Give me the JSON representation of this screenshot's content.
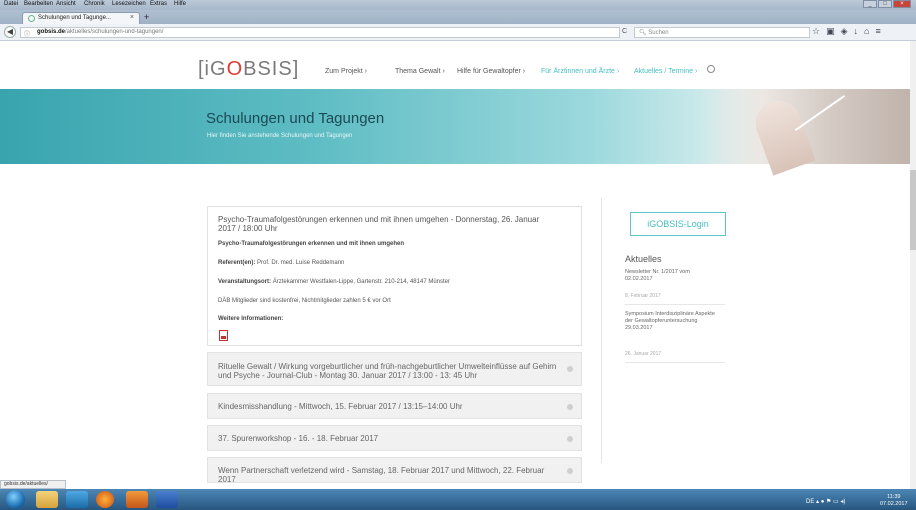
{
  "browser": {
    "menu": [
      "Datei",
      "Bearbeiten",
      "Ansicht",
      "Chronik",
      "Lesezeichen",
      "Extras",
      "Hilfe"
    ],
    "tab_title": "Schulungen und Tagunge...",
    "tab_close": "×",
    "new_tab": "+",
    "url_domain": "gobsis.de",
    "url_path": "/aktuelles/schulungen-und-tagungen/",
    "search_placeholder": "Suchen",
    "status_text": "gobsis.de/aktuelles/"
  },
  "site": {
    "logo_left": "[iG",
    "logo_accent": "O",
    "logo_right": "BSIS]",
    "nav": [
      {
        "label": "Zum Projekt",
        "active": false
      },
      {
        "label": "Thema Gewalt",
        "active": false
      },
      {
        "label": "Hilfe für Gewaltopfer",
        "active": false
      },
      {
        "label": "Für Ärztinnen und Ärzte",
        "active": true
      },
      {
        "label": "Aktuelles / Termine",
        "active": true
      }
    ]
  },
  "banner": {
    "title": "Schulungen und Tagungen",
    "subtitle": "Hier finden Sie anstehende Schulungen und Tagungen"
  },
  "events": {
    "expanded": {
      "title": "Psycho-Traumafolgestörungen erkennen und mit ihnen umgehen - Donnerstag, 26. Januar 2017 / 18:00 Uhr",
      "subtitle": "Psycho-Traumafolgestörungen erkennen und mit ihnen umgehen",
      "speaker_label": "Referent(en):",
      "speaker": "Prof. Dr. med. Luise Reddemann",
      "venue_label": "Veranstaltungsort:",
      "venue": "Ärztekammer Westfalen-Lippe, Gartenstr. 210-214, 48147 Münster",
      "fee": "DÄB Mitglieder sind kostenfrei, Nichtmitglieder zahlen 5 € vor Ort",
      "more_label": "Weitere Informationen:"
    },
    "collapsed": [
      "Rituelle Gewalt / Wirkung vorgeburtlicher und früh-nachgeburtlicher Umwelteinflüsse auf Gehirn und Psyche - Journal-Club - Montag 30. Januar 2017 / 13:00 - 13: 45 Uhr",
      "Kindesmisshandlung - Mittwoch, 15. Februar 2017 / 13:15–14:00 Uhr",
      "37. Spurenworkshop - 16. - 18. Februar 2017",
      "Wenn Partnerschaft verletzend wird - Samstag, 18. Februar 2017 und Mittwoch, 22. Februar 2017"
    ]
  },
  "sidebar": {
    "login_label": "iGOBSIS-Login",
    "news_title": "Aktuelles",
    "news": [
      {
        "title": "Newsletter Nr. 1/2017 vom 02.02.2017",
        "date": "8. Februar 2017"
      },
      {
        "title": "Symposium Interdisziplinäre Aspekte der Gewaltopferuntersuchung 29.03.2017",
        "date": "26. Januar 2017"
      }
    ]
  },
  "taskbar": {
    "lang": "DE",
    "time": "11:39",
    "date": "07.02.2017"
  }
}
